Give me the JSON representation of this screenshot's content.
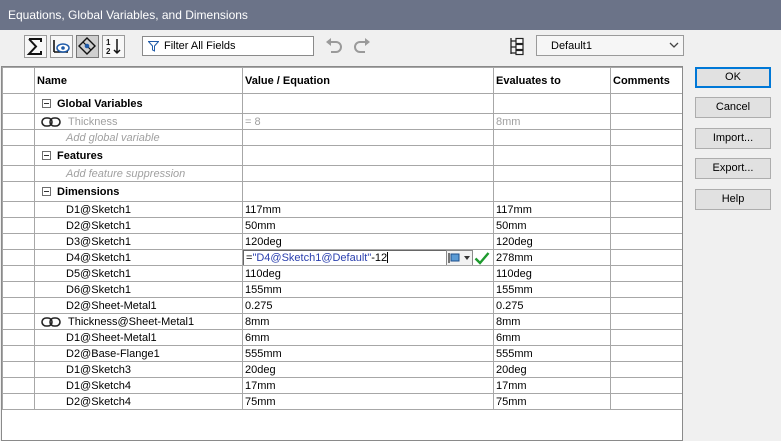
{
  "window": {
    "title": "Equations, Global Variables, and Dimensions"
  },
  "toolbar": {
    "filter_label": "Filter All Fields",
    "configuration": "Default1"
  },
  "table": {
    "headers": [
      "Name",
      "Value / Equation",
      "Evaluates to",
      "Comments"
    ],
    "global_variables": {
      "label": "Global Variables",
      "rows": [
        {
          "name": "Thickness",
          "value": "= 8",
          "evaluates": "8mm"
        }
      ],
      "add_placeholder": "Add global variable"
    },
    "features": {
      "label": "Features",
      "add_placeholder": "Add feature suppression"
    },
    "dimensions": {
      "label": "Dimensions",
      "rows": [
        {
          "name": "D1@Sketch1",
          "value": "117mm",
          "evaluates": "117mm"
        },
        {
          "name": "D2@Sketch1",
          "value": "50mm",
          "evaluates": "50mm"
        },
        {
          "name": "D3@Sketch1",
          "value": "120deg",
          "evaluates": "120deg"
        },
        {
          "name": "D4@Sketch1",
          "value_prefix": "=",
          "value_ref": "\"D4@Sketch1@Default\"",
          "value_suffix": "-12",
          "evaluates": "278mm"
        },
        {
          "name": "D5@Sketch1",
          "value": "110deg",
          "evaluates": "110deg"
        },
        {
          "name": "D6@Sketch1",
          "value": "155mm",
          "evaluates": "155mm"
        },
        {
          "name": "D2@Sheet-Metal1",
          "value": "0.275",
          "evaluates": "0.275"
        },
        {
          "name": "Thickness@Sheet-Metal1",
          "value": "8mm",
          "evaluates": "8mm"
        },
        {
          "name": "D1@Sheet-Metal1",
          "value": "6mm",
          "evaluates": "6mm"
        },
        {
          "name": "D2@Base-Flange1",
          "value": "555mm",
          "evaluates": "555mm"
        },
        {
          "name": "D1@Sketch3",
          "value": "20deg",
          "evaluates": "20deg"
        },
        {
          "name": "D1@Sketch4",
          "value": "17mm",
          "evaluates": "17mm"
        },
        {
          "name": "D2@Sketch4",
          "value": "75mm",
          "evaluates": "75mm"
        }
      ]
    }
  },
  "buttons": {
    "ok": "OK",
    "cancel": "Cancel",
    "import": "Import...",
    "export": "Export...",
    "help": "Help"
  },
  "colors": {
    "titlebar": "#6b7388",
    "equation_reference": "#2a3fae",
    "default_button_border": "#0078d7"
  }
}
